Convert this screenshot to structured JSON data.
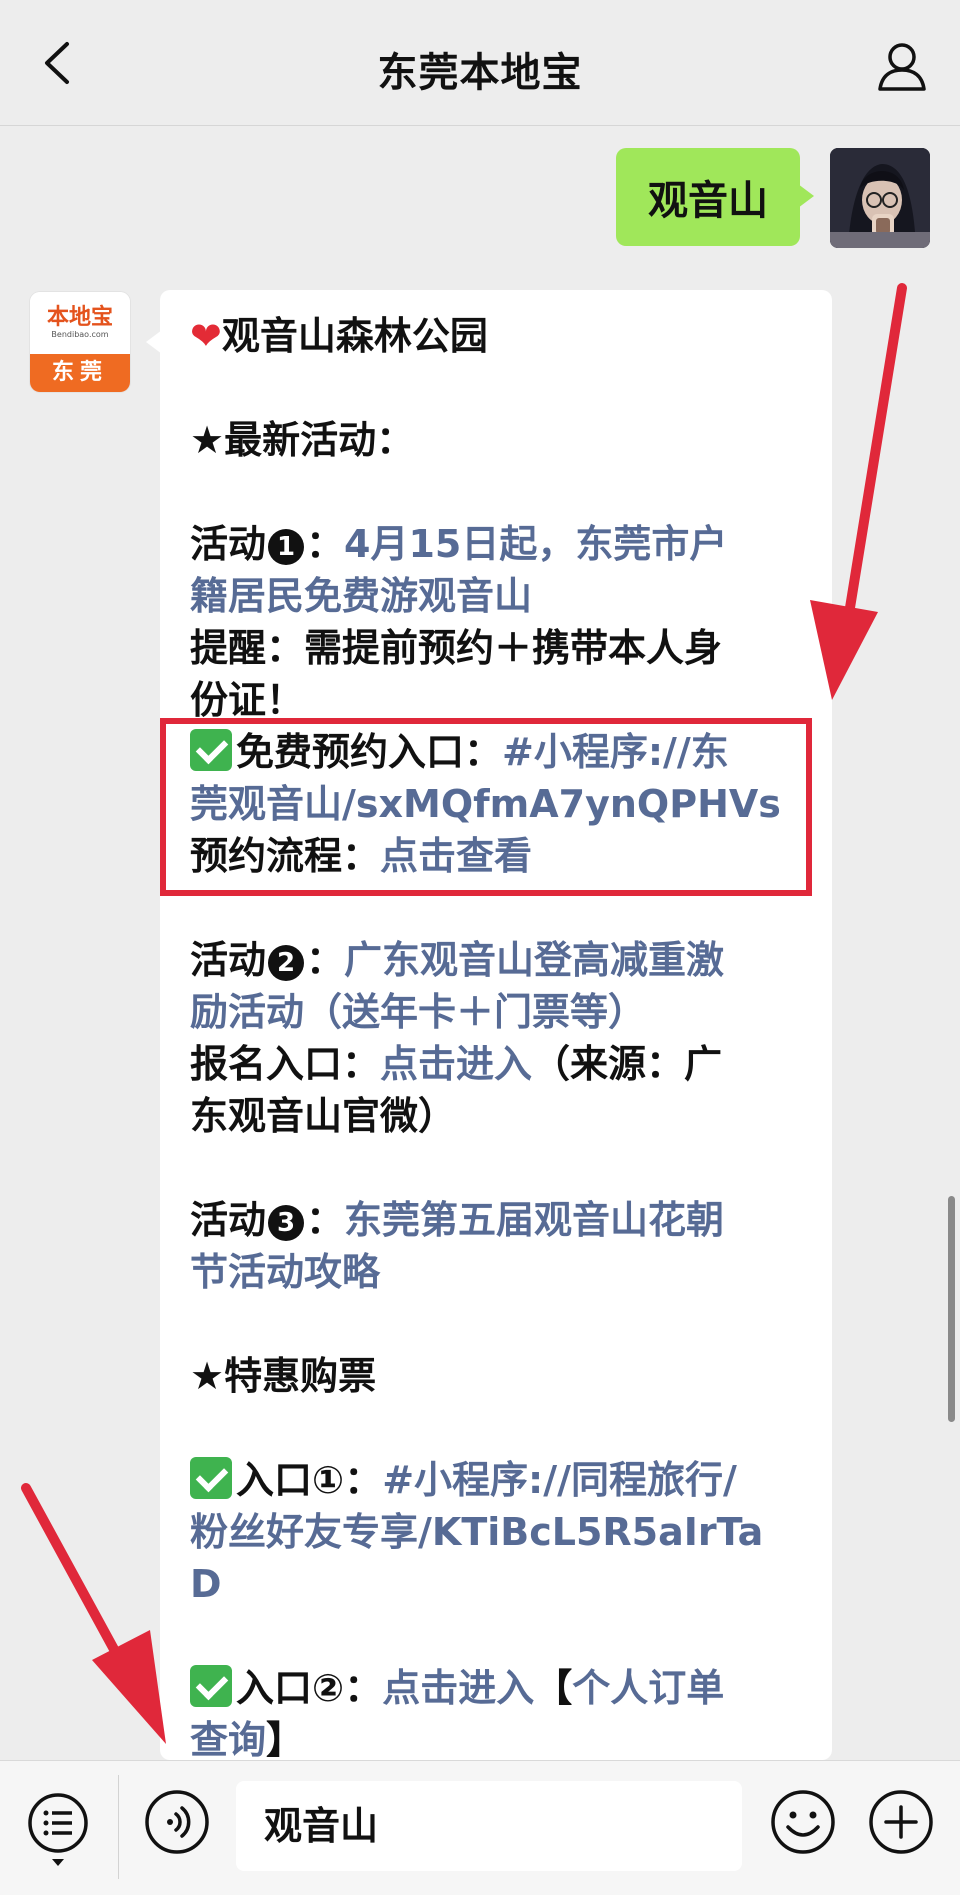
{
  "header": {
    "title": "东莞本地宝"
  },
  "outgoing": {
    "text": "观音山"
  },
  "bot": {
    "logo_text": "本地宝",
    "logo_sub": "Bendibao.com",
    "logo_city": "东莞"
  },
  "message": {
    "title": "观音山森林公园",
    "section1": "★最新活动：",
    "act1_label": "活动",
    "act1_num": "1",
    "act1_colon": "：",
    "act1_link_a": "4月15日起，东莞市户",
    "act1_link_b": "籍居民免费游观音山",
    "remind_a": "提醒：需提前预约＋携带本人身",
    "remind_b": "份证！",
    "entry_label": "免费预约入口：",
    "entry_link_a": "#小程序://东",
    "entry_link_b": "莞观音山/sxMQfmA7ynQPHVs",
    "flow_label": "预约流程：",
    "flow_link": "点击查看",
    "act2_label": "活动",
    "act2_num": "2",
    "act2_colon": "：",
    "act2_link_a": "广东观音山登高减重激",
    "act2_link_b": "励活动（送年卡＋门票等）",
    "signup_label": "报名入口：",
    "signup_link": "点击进入",
    "signup_src_a": "（来源：广",
    "signup_src_b": "东观音山官微）",
    "act3_label": "活动",
    "act3_num": "3",
    "act3_colon": "：",
    "act3_link_a": "东莞第五届观音山花朝",
    "act3_link_b": "节活动攻略",
    "section2": "★特惠购票",
    "e1_label": "入口",
    "e1_num": "①",
    "e1_colon": "：",
    "e1_link_a": "#小程序://同程旅行/",
    "e1_link_b": "粉丝好友专享/KTiBcL5R5aIrTa",
    "e1_link_c": "D",
    "e2_label": "入口",
    "e2_num": "②",
    "e2_colon": "：",
    "e2_link": "点击进入",
    "e2_bracket_open": "【",
    "e2_link2_a": "个人订单",
    "e2_link2_b": "查询",
    "e2_bracket_close": "】"
  },
  "input": {
    "value": "观音山"
  },
  "colors": {
    "background": "#ededed",
    "outgoing_bubble": "#a0e75a",
    "link": "#576b95",
    "highlight": "#e0283a",
    "brand": "#ef6b22"
  },
  "icons": [
    "back-arrow-icon",
    "profile-icon",
    "menu-list-icon",
    "voice-icon",
    "emoji-icon",
    "plus-icon",
    "heart-icon",
    "check-icon"
  ]
}
